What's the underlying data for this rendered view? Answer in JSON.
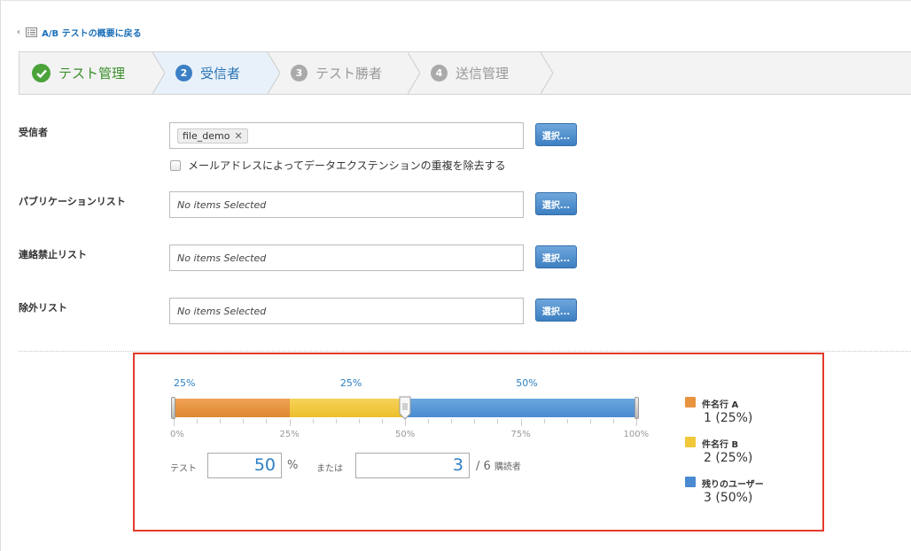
{
  "nav": {
    "back_label": "A/B テストの概要に戻る"
  },
  "steps": [
    {
      "num": "",
      "label": "テスト管理",
      "state": "done"
    },
    {
      "num": "2",
      "label": "受信者",
      "state": "active"
    },
    {
      "num": "3",
      "label": "テスト勝者",
      "state": "pending"
    },
    {
      "num": "4",
      "label": "送信管理",
      "state": "pending"
    }
  ],
  "form": {
    "recipients": {
      "label": "受信者",
      "tag": "file_demo",
      "button": "選択..."
    },
    "dedupe_label": "メールアドレスによってデータエクステンションの重複を除去する",
    "publication": {
      "label": "パブリケーションリスト",
      "placeholder": "No items Selected",
      "button": "選択..."
    },
    "suppression": {
      "label": "連絡禁止リスト",
      "placeholder": "No items Selected",
      "button": "選択..."
    },
    "exclusion": {
      "label": "除外リスト",
      "placeholder": "No items Selected",
      "button": "選択..."
    }
  },
  "split": {
    "segments": [
      {
        "name": "件名行 A",
        "percent": 25,
        "pct_label": "25%",
        "color": "#e8943f",
        "value_label": "1 (25%)"
      },
      {
        "name": "件名行 B",
        "percent": 25,
        "pct_label": "25%",
        "color": "#f1c83a",
        "value_label": "2 (25%)"
      },
      {
        "name": "残りのユーザー",
        "percent": 50,
        "pct_label": "50%",
        "color": "#4a8ad0",
        "value_label": "3 (50%)"
      }
    ],
    "tick_labels": [
      "0%",
      "25%",
      "50%",
      "75%",
      "100%"
    ],
    "test_label": "テスト",
    "test_percent": "50",
    "percent_unit": "%",
    "or_label": "または",
    "test_count": "3",
    "total_prefix": "/ 6",
    "total_unit": "購読者"
  }
}
